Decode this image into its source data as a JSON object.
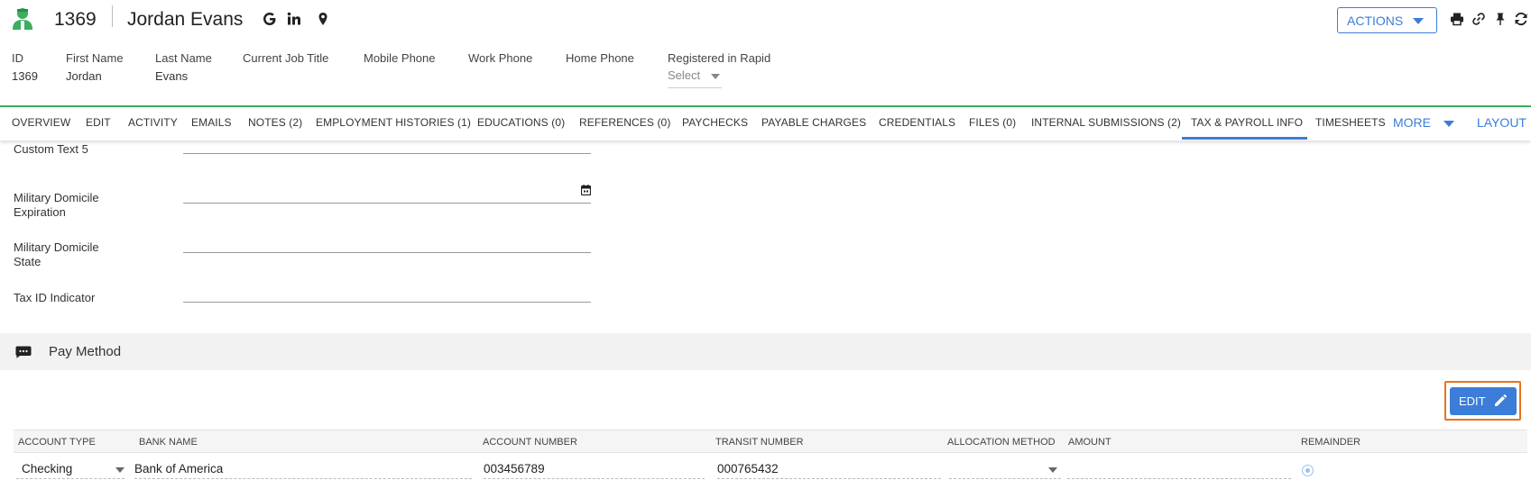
{
  "header": {
    "record_id": "1369",
    "name": "Jordan Evans",
    "actions_label": "ACTIONS",
    "icons": [
      "google-icon",
      "linkedin-icon",
      "location-pin-icon",
      "print-icon",
      "link-icon",
      "pin-icon",
      "refresh-icon"
    ]
  },
  "info": {
    "id_label": "ID",
    "id_value": "1369",
    "first_name_label": "First Name",
    "first_name_value": "Jordan",
    "last_name_label": "Last Name",
    "last_name_value": "Evans",
    "job_title_label": "Current Job Title",
    "mobile_label": "Mobile Phone",
    "work_label": "Work Phone",
    "home_label": "Home Phone",
    "rapid_label": "Registered in Rapid",
    "rapid_value": "Select"
  },
  "tabs": [
    "OVERVIEW",
    "EDIT",
    "ACTIVITY",
    "EMAILS",
    "NOTES (2)",
    "EMPLOYMENT HISTORIES (1)",
    "EDUCATIONS (0)",
    "REFERENCES (0)",
    "PAYCHECKS",
    "PAYABLE CHARGES",
    "CREDENTIALS",
    "FILES (0)",
    "INTERNAL SUBMISSIONS (2)",
    "TAX & PAYROLL INFO",
    "TIMESHEETS"
  ],
  "active_tab": "TAX & PAYROLL INFO",
  "more_label": "MORE",
  "layout_label": "LAYOUT",
  "form": {
    "custom_text_5": "Custom Text 5",
    "military_domicile_expiration": "Military Domicile Expiration",
    "military_domicile_state": "Military Domicile State",
    "tax_id_indicator": "Tax ID Indicator"
  },
  "section": {
    "title": "Pay Method",
    "edit_label": "EDIT"
  },
  "table": {
    "headers": [
      "ACCOUNT TYPE",
      "BANK NAME",
      "ACCOUNT NUMBER",
      "TRANSIT NUMBER",
      "ALLOCATION METHOD",
      "AMOUNT",
      "REMAINDER"
    ],
    "row": {
      "account_type": "Checking",
      "bank_name": "Bank of America",
      "account_number": "003456789",
      "transit_number": "000765432",
      "allocation_method": "",
      "amount": ""
    }
  },
  "colors": {
    "accent": "#3b7dd8",
    "green": "#3cae5f",
    "highlight": "#e8731e"
  }
}
